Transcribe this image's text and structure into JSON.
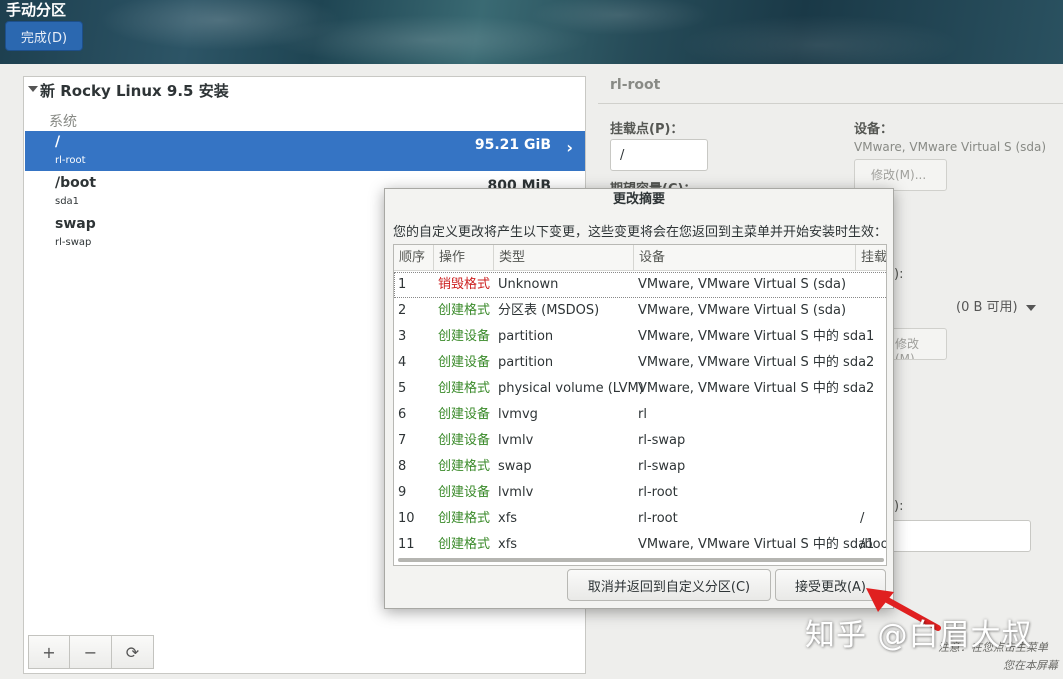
{
  "header": {
    "title": "手动分区",
    "done_label": "完成(D)"
  },
  "left_panel": {
    "install_title": "新 Rocky Linux 9.5 安装",
    "section_label": "系统",
    "mount_points": [
      {
        "name": "/",
        "device": "rl-root",
        "size": "95.21 GiB",
        "selected": true
      },
      {
        "name": "/boot",
        "device": "sda1",
        "size": "800 MiB"
      },
      {
        "name": "swap",
        "device": "rl-swap",
        "size": ""
      }
    ],
    "tools": {
      "add": "+",
      "remove": "−",
      "refresh": "⟳"
    }
  },
  "right_panel": {
    "title": "rl-root",
    "mount_point_label": "挂载点(P)：",
    "mount_point_value": "/",
    "capacity_label": "期望容量(C)：",
    "device_label": "设备：",
    "device_value": "VMware, VMware Virtual S (sda)",
    "modify_label": "修改(M)...",
    "modify2_label": "修改(M)...",
    "volume_group_free": "(0 B 可用)",
    "paren_colon_1": "):",
    "paren_colon_2": "):",
    "footnote_1": "注意：在您点击主菜单",
    "footnote_2": "您在本屏幕"
  },
  "dialog": {
    "title": "更改摘要",
    "description": "您的自定义更改将产生以下变更，这些变更将会在您返回到主菜单并开始安装时生效：",
    "columns": [
      "顺序",
      "操作",
      "类型",
      "设备",
      "挂载"
    ],
    "rows": [
      {
        "order": "1",
        "action": "销毁格式",
        "type": "Unknown",
        "device": "VMware, VMware Virtual S (sda)",
        "mount": ""
      },
      {
        "order": "2",
        "action": "创建格式",
        "type": "分区表 (MSDOS)",
        "device": "VMware, VMware Virtual S (sda)",
        "mount": ""
      },
      {
        "order": "3",
        "action": "创建设备",
        "type": "partition",
        "device": "VMware, VMware Virtual S 中的 sda1",
        "mount": ""
      },
      {
        "order": "4",
        "action": "创建设备",
        "type": "partition",
        "device": "VMware, VMware Virtual S 中的 sda2",
        "mount": ""
      },
      {
        "order": "5",
        "action": "创建格式",
        "type": "physical volume (LVM)",
        "device": "VMware, VMware Virtual S 中的 sda2",
        "mount": ""
      },
      {
        "order": "6",
        "action": "创建设备",
        "type": "lvmvg",
        "device": "rl",
        "mount": ""
      },
      {
        "order": "7",
        "action": "创建设备",
        "type": "lvmlv",
        "device": "rl-swap",
        "mount": ""
      },
      {
        "order": "8",
        "action": "创建格式",
        "type": "swap",
        "device": "rl-swap",
        "mount": ""
      },
      {
        "order": "9",
        "action": "创建设备",
        "type": "lvmlv",
        "device": "rl-root",
        "mount": ""
      },
      {
        "order": "10",
        "action": "创建格式",
        "type": "xfs",
        "device": "rl-root",
        "mount": "/"
      },
      {
        "order": "11",
        "action": "创建格式",
        "type": "xfs",
        "device": "VMware, VMware Virtual S 中的 sda1",
        "mount": "/boot"
      }
    ],
    "cancel_label": "取消并返回到自定义分区(C)",
    "accept_label": "接受更改(A)"
  },
  "watermark": "知乎 @白眉大叔",
  "colors": {
    "selected_row": "#3574c4",
    "destroy": "#cc1f1f",
    "create": "#3a8a2a",
    "arrow": "#e02020"
  }
}
